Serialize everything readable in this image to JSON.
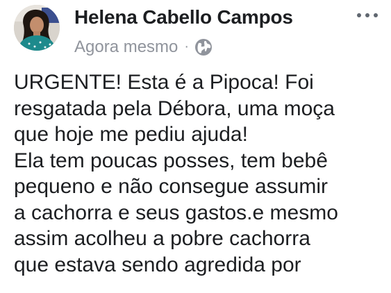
{
  "post": {
    "author_name": "Helena Cabello Campos",
    "timestamp": "Agora mesmo",
    "separator": "·",
    "privacy_icon": "globe-icon",
    "more_icon": "more-options-icon",
    "body_lines": [
      "URGENTE! Esta é a Pipoca! Foi",
      "resgatada pela Débora, uma moça",
      "que hoje me pediu ajuda!",
      "Ela tem poucas posses, tem bebê",
      "pequeno e não consegue assumir",
      "a cachorra e seus gastos.e mesmo",
      "assim acolheu a pobre cachorra",
      "que estava sendo agredida por"
    ]
  },
  "colors": {
    "text_primary": "#1c1e21",
    "text_secondary": "#90949c",
    "background": "#ffffff"
  }
}
